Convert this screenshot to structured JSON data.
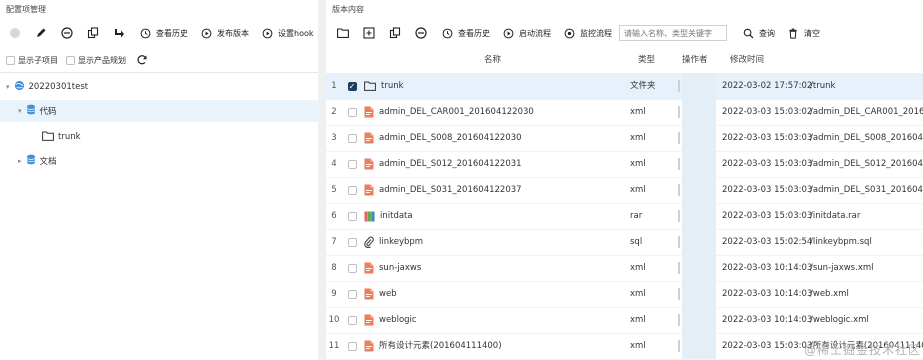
{
  "left": {
    "title": "配置项管理",
    "toolbar": {
      "view_history": "查看历史",
      "publish_version": "发布版本",
      "set_hook": "设置hook"
    },
    "options": {
      "show_children": "显示子项目",
      "show_product_plan": "显示产品规划"
    },
    "tree": [
      {
        "label": "20220301test",
        "icon": "globe-icon",
        "expanded": true
      },
      {
        "label": "代码",
        "icon": "database-icon",
        "expanded": true,
        "selected": true
      },
      {
        "label": "trunk",
        "icon": "folder-icon"
      },
      {
        "label": "文档",
        "icon": "database-icon",
        "expanded": false
      }
    ]
  },
  "right": {
    "title": "版本内容",
    "toolbar": {
      "view_history": "查看历史",
      "start_flow": "启动流程",
      "monitor_flow": "监控流程",
      "search_placeholder": "请输入名称、类型关键字",
      "query": "查询",
      "clear": "清空"
    },
    "columns": {
      "name": "名称",
      "type": "类型",
      "operator": "操作者",
      "modified": "修改时间"
    },
    "rows": [
      {
        "idx": "1",
        "name": "trunk",
        "icon": "folder-icon",
        "type": "文件夹",
        "time": "2022-03-02 17:57:02",
        "path": "/trunk",
        "checked": true
      },
      {
        "idx": "2",
        "name": "admin_DEL_CAR001_201604122030",
        "icon": "file-icon",
        "type": "xml",
        "time": "2022-03-03 15:03:02",
        "path": "/admin_DEL_CAR001_201604",
        "checked": false
      },
      {
        "idx": "3",
        "name": "admin_DEL_S008_201604122030",
        "icon": "file-icon",
        "type": "xml",
        "time": "2022-03-03 15:03:03",
        "path": "/admin_DEL_S008_201604",
        "checked": false
      },
      {
        "idx": "4",
        "name": "admin_DEL_S012_201604122031",
        "icon": "file-icon",
        "type": "xml",
        "time": "2022-03-03 15:03:03",
        "path": "/admin_DEL_S012_201604",
        "checked": false
      },
      {
        "idx": "5",
        "name": "admin_DEL_S031_201604122037",
        "icon": "file-icon",
        "type": "xml",
        "time": "2022-03-03 15:03:03",
        "path": "/admin_DEL_S031_201604",
        "checked": false
      },
      {
        "idx": "6",
        "name": "initdata",
        "icon": "archive-icon",
        "type": "rar",
        "time": "2022-03-03 15:03:03",
        "path": "/initdata.rar",
        "checked": false
      },
      {
        "idx": "7",
        "name": "linkeybpm",
        "icon": "attachment-icon",
        "type": "sql",
        "time": "2022-03-03 15:02:54",
        "path": "/linkeybpm.sql",
        "checked": false
      },
      {
        "idx": "8",
        "name": "sun-jaxws",
        "icon": "file-icon",
        "type": "xml",
        "time": "2022-03-03 10:14:03",
        "path": "/sun-jaxws.xml",
        "checked": false
      },
      {
        "idx": "9",
        "name": "web",
        "icon": "file-icon",
        "type": "xml",
        "time": "2022-03-03 10:14:03",
        "path": "/web.xml",
        "checked": false
      },
      {
        "idx": "10",
        "name": "weblogic",
        "icon": "file-icon",
        "type": "xml",
        "time": "2022-03-03 10:14:03",
        "path": "/weblogic.xml",
        "checked": false
      },
      {
        "idx": "11",
        "name": "所有设计元素(201604111400)",
        "icon": "file-icon",
        "type": "xml",
        "time": "2022-03-03 15:03:03",
        "path": "/所有设计元素(201604111400",
        "checked": false
      }
    ]
  },
  "watermark": "@稀土掘金技术社区",
  "colors": {
    "accent": "#1f3d5c",
    "file_icon": "#f07c5a",
    "folder_icon": "#333333",
    "db_icon": "#4a90d9",
    "selected_row": "#e6f1fb"
  }
}
